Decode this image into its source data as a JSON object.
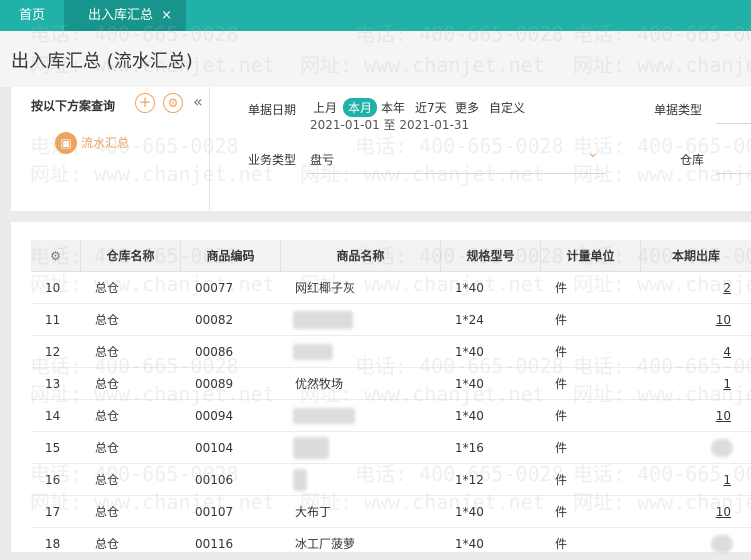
{
  "tabs": {
    "home": "首页",
    "active": "出入库汇总",
    "close": "×"
  },
  "page_title": "出入库汇总 (流水汇总)",
  "scheme": {
    "title": "按以下方案查询",
    "add_icon": "plus-icon",
    "settings_icon": "gear-icon",
    "collapse_icon": "«",
    "item_label": "流水汇总",
    "item_icon": "box-icon"
  },
  "filters": {
    "date_label": "单据日期",
    "date_options": [
      "上月",
      "本月",
      "本年",
      "近7天",
      "更多",
      "自定义"
    ],
    "active_option": "本月",
    "date_range": "2021-01-01 至 2021-01-31",
    "doc_type_label": "单据类型",
    "biz_type_label": "业务类型",
    "biz_type_value": "盘亏",
    "warehouse_label": "仓库"
  },
  "table": {
    "columns": [
      "仓库名称",
      "商品编码",
      "商品名称",
      "规格型号",
      "计量单位",
      "本期出库"
    ],
    "rows": [
      {
        "no": "10",
        "wh": "总仓",
        "code": "00077",
        "name": "网红椰子灰",
        "spec": "1*40",
        "unit": "件",
        "out": "2"
      },
      {
        "no": "11",
        "wh": "总仓",
        "code": "00082",
        "name": "",
        "spec": "1*24",
        "unit": "件",
        "out": "10"
      },
      {
        "no": "12",
        "wh": "总仓",
        "code": "00086",
        "name": "",
        "spec": "1*40",
        "unit": "件",
        "out": "4"
      },
      {
        "no": "13",
        "wh": "总仓",
        "code": "00089",
        "name": "优然牧场",
        "spec": "1*40",
        "unit": "件",
        "out": "1"
      },
      {
        "no": "14",
        "wh": "总仓",
        "code": "00094",
        "name": "",
        "spec": "1*40",
        "unit": "件",
        "out": "10"
      },
      {
        "no": "15",
        "wh": "总仓",
        "code": "00104",
        "name": "",
        "spec": "1*16",
        "unit": "件",
        "out": ""
      },
      {
        "no": "16",
        "wh": "总仓",
        "code": "00106",
        "name": "",
        "spec": "1*12",
        "unit": "件",
        "out": "1"
      },
      {
        "no": "17",
        "wh": "总仓",
        "code": "00107",
        "name": "大布丁",
        "spec": "1*40",
        "unit": "件",
        "out": "10"
      },
      {
        "no": "18",
        "wh": "总仓",
        "code": "00116",
        "name": "冰工厂菠萝",
        "spec": "1*40",
        "unit": "件",
        "out": ""
      }
    ]
  },
  "watermark": {
    "phone": "电话: 400-665-0028",
    "url": "网址: www.chanjet.net"
  },
  "colors": {
    "accent": "#20b2a8",
    "orange": "#f0a35a"
  }
}
